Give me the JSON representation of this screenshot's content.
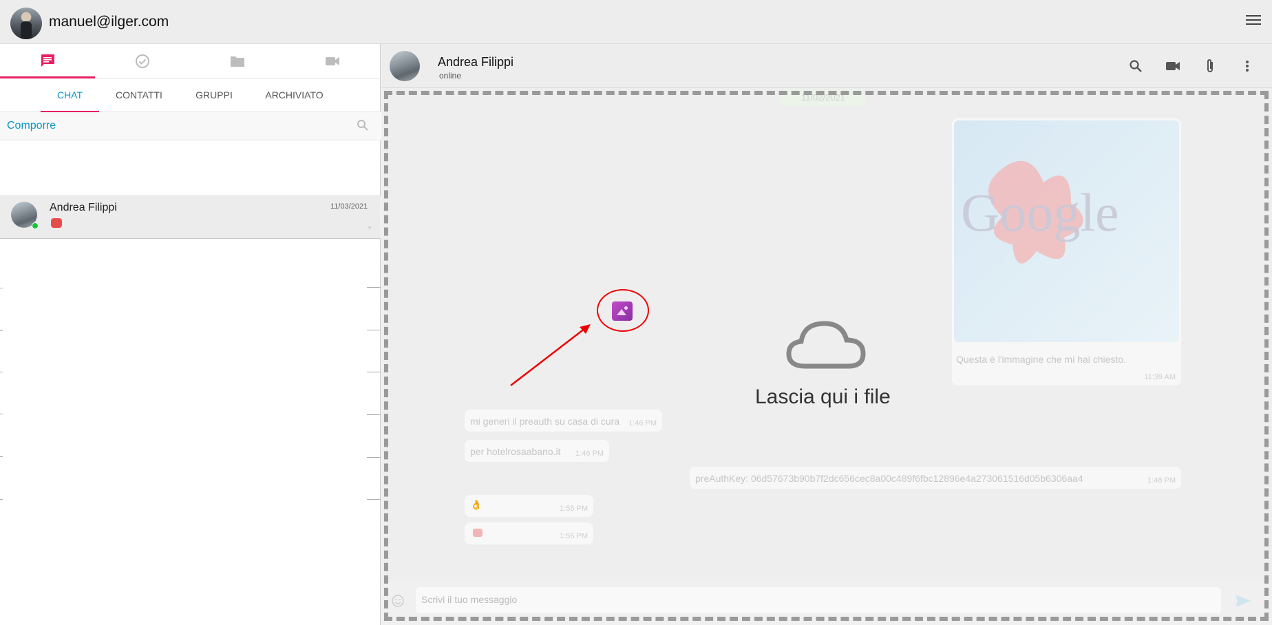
{
  "topbar": {
    "email": "manuel@ilger.com"
  },
  "left": {
    "text_tabs": [
      "CHAT",
      "CONTATTI",
      "GRUPPI",
      "ARCHIVIATO"
    ],
    "compose_label": "Comporre",
    "chat": {
      "name": "Andrea Filippi",
      "date": "11/03/2021"
    }
  },
  "right": {
    "contact": {
      "name": "Andrea Filippi",
      "status": "online"
    },
    "date_chip": "11/02/2021",
    "image_caption": "Questa è l'immagine che mi hai chiesto.",
    "image_time": "11:39 AM",
    "messages": [
      {
        "text": "mi generi il preauth su casa di cura",
        "time": "1:46 PM"
      },
      {
        "text": "per hotelrosaabano.it",
        "time": "1:46 PM"
      },
      {
        "text": "preAuthKey: 06d57673b90b7f2dc656cec8a00c489f6fbc12896e4a273061516d05b6306aa4",
        "time": "1:48 PM"
      },
      {
        "text": "👌",
        "time": "1:55 PM"
      },
      {
        "text": "",
        "time": "1:55 PM"
      }
    ],
    "drop_text": "Lascia qui i file",
    "input_placeholder": "Scrivi il tuo messaggio"
  }
}
